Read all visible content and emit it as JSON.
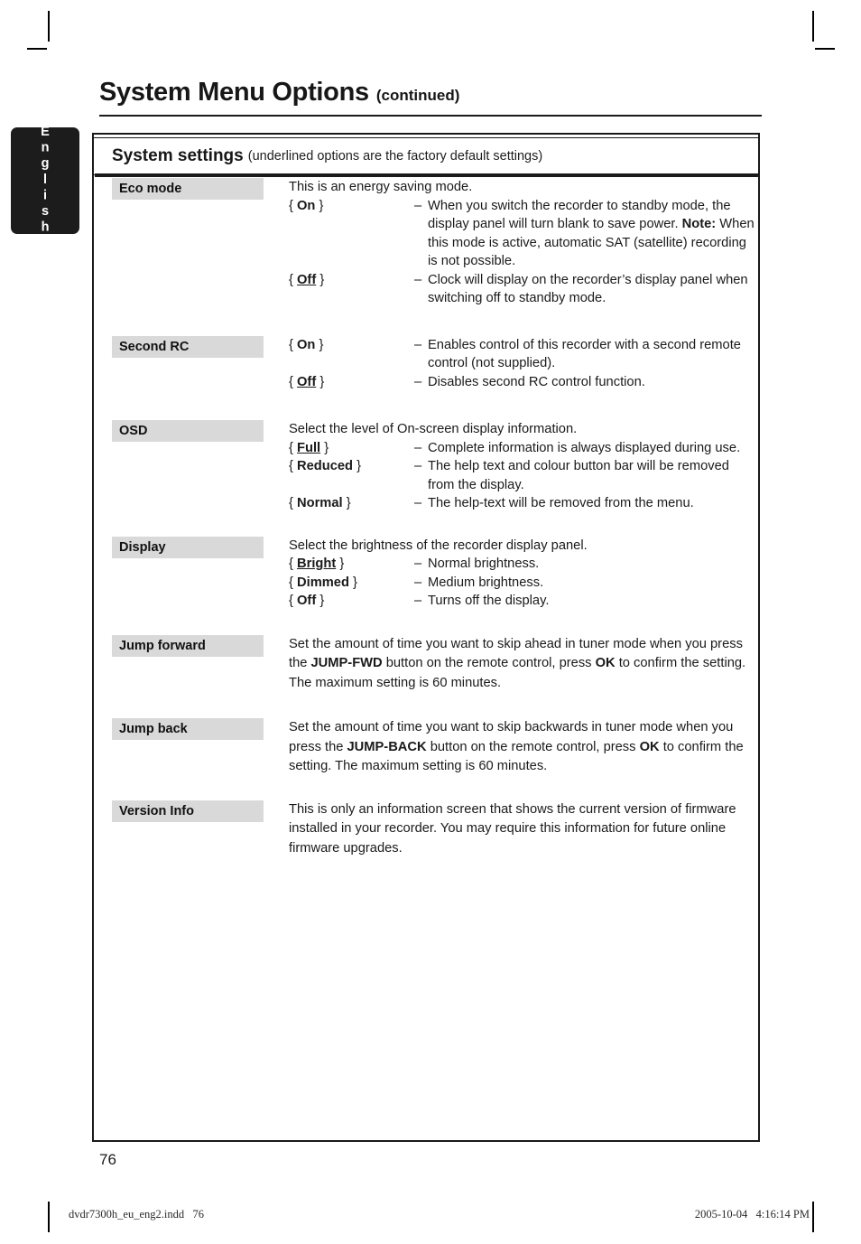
{
  "sidebar": {
    "language_tab": "English"
  },
  "header": {
    "title": "System Menu Options",
    "subtitle": "(continued)"
  },
  "settings_banner": {
    "title": "System settings",
    "note": "(underlined options are the factory default settings)"
  },
  "sections": [
    {
      "label": "Eco mode",
      "intro": "This is an energy saving mode.",
      "options": [
        {
          "open_brace": "{",
          "value": "On",
          "close_brace": "}",
          "underlined": false,
          "dash": "–",
          "desc_pre": "When you switch the recorder to standby mode, the display panel will turn blank to save power. ",
          "desc_bold": "Note:",
          "desc_post": " When this mode is active, automatic SAT (satellite) recording is not possible."
        },
        {
          "open_brace": "{",
          "value": "Off",
          "close_brace": "}",
          "underlined": true,
          "dash": "–",
          "desc_pre": "Clock will display on the recorder’s display panel when switching off to standby mode.",
          "desc_bold": "",
          "desc_post": ""
        }
      ]
    },
    {
      "label": "Second RC",
      "intro": "",
      "options": [
        {
          "open_brace": "{",
          "value": "On",
          "close_brace": "}",
          "underlined": false,
          "dash": "–",
          "desc_pre": "Enables control of this recorder with a second remote control (not supplied).",
          "desc_bold": "",
          "desc_post": ""
        },
        {
          "open_brace": "{",
          "value": "Off",
          "close_brace": "}",
          "underlined": true,
          "dash": "–",
          "desc_pre": "Disables second RC control function.",
          "desc_bold": "",
          "desc_post": ""
        }
      ]
    },
    {
      "label": "OSD",
      "intro": "Select the level of On-screen display information.",
      "options": [
        {
          "open_brace": "{",
          "value": "Full",
          "close_brace": "}",
          "underlined": true,
          "dash": "–",
          "desc_pre": "Complete information is always displayed during use.",
          "desc_bold": "",
          "desc_post": ""
        },
        {
          "open_brace": "{",
          "value": "Reduced",
          "close_brace": "}",
          "underlined": false,
          "dash": "–",
          "desc_pre": "The help text and colour button bar will be removed from the display.",
          "desc_bold": "",
          "desc_post": ""
        },
        {
          "open_brace": "{",
          "value": "Normal",
          "close_brace": "}",
          "underlined": false,
          "dash": "–",
          "desc_pre": "The help-text will be removed from the menu.",
          "desc_bold": "",
          "desc_post": ""
        }
      ]
    },
    {
      "label": "Display",
      "intro": "Select the brightness of the recorder display panel.",
      "options": [
        {
          "open_brace": "{",
          "value": "Bright",
          "close_brace": "}",
          "underlined": true,
          "dash": "–",
          "desc_pre": "Normal brightness.",
          "desc_bold": "",
          "desc_post": ""
        },
        {
          "open_brace": "{",
          "value": "Dimmed",
          "close_brace": "}",
          "underlined": false,
          "dash": "–",
          "desc_pre": "Medium brightness.",
          "desc_bold": "",
          "desc_post": ""
        },
        {
          "open_brace": "{",
          "value": "Off",
          "close_brace": "}",
          "underlined": false,
          "dash": "–",
          "desc_pre": "Turns off the display.",
          "desc_bold": "",
          "desc_post": ""
        }
      ]
    }
  ],
  "paragraph_sections": [
    {
      "label": "Jump forward",
      "p1": "Set the amount of time you want to skip ahead in tuner mode when you press the ",
      "b1": "JUMP-FWD",
      "p2": " button on the remote control, press ",
      "b2": "OK",
      "p3": " to confirm the setting. The maximum setting is 60 minutes."
    },
    {
      "label": "Jump back",
      "p1": "Set the amount of time you want to skip backwards in tuner mode when you press the ",
      "b1": "JUMP-BACK",
      "p2": " button on the remote control, press ",
      "b2": "OK",
      "p3": " to confirm the setting. The maximum setting is 60 minutes."
    }
  ],
  "version_section": {
    "label": "Version Info",
    "text": "This is only an information screen that shows the current version of firmware installed in your recorder. You may require this information for future online firmware upgrades."
  },
  "page_number": "76",
  "print_footer": {
    "file": "dvdr7300h_eu_eng2.indd   76",
    "timestamp": "2005-10-04   4:16:14 PM"
  },
  "colors": {
    "label_background": "#d9d9d9",
    "ink": "#1a1a1a",
    "tab_background": "#1c1c1c"
  }
}
